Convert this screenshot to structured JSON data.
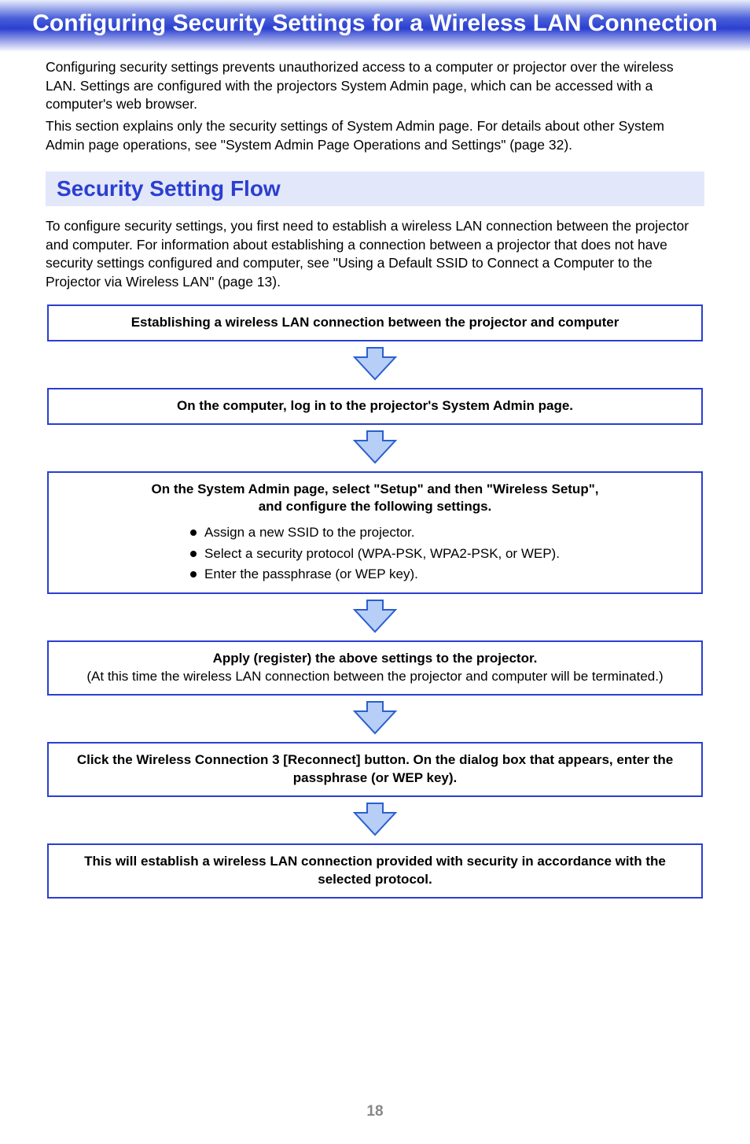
{
  "banner_title": "Configuring Security Settings for a Wireless LAN Connection",
  "intro_p1": "Configuring security settings prevents unauthorized access to a computer or projector over the wireless LAN. Settings are configured with the projectors System Admin page, which can be accessed with a computer's web browser.",
  "intro_p2": "This section explains only the security settings of System Admin page. For details about other System Admin page operations, see \"System Admin Page Operations and Settings\" (page 32).",
  "section_heading": "Security Setting Flow",
  "section_intro": "To configure security settings, you first need to establish a wireless LAN connection between the projector and computer. For information about establishing a connection between a projector that does not have security settings configured and computer, see \"Using a Default SSID to Connect a Computer to the Projector via Wireless LAN\" (page 13).",
  "flow": {
    "step1": "Establishing a wireless LAN connection between the projector and computer",
    "step2": "On the computer, log in to the projector's System Admin page.",
    "step3_line1": "On the System Admin page, select \"Setup\" and then \"Wireless Setup\",",
    "step3_line2": "and configure the following settings.",
    "step3_bullets": {
      "b1": "Assign a new SSID to the projector.",
      "b2": "Select a security protocol (WPA-PSK, WPA2-PSK, or WEP).",
      "b3": "Enter the passphrase (or WEP key)."
    },
    "step4_main": "Apply (register) the above settings to the projector.",
    "step4_sub": "(At this time the wireless LAN connection between the projector and computer will be terminated.)",
    "step5": "Click the Wireless Connection 3 [Reconnect] button. On the dialog box that appears, enter the passphrase (or WEP key).",
    "step6": "This will establish a wireless LAN connection provided with security in accordance with the selected protocol."
  },
  "page_number": "18"
}
